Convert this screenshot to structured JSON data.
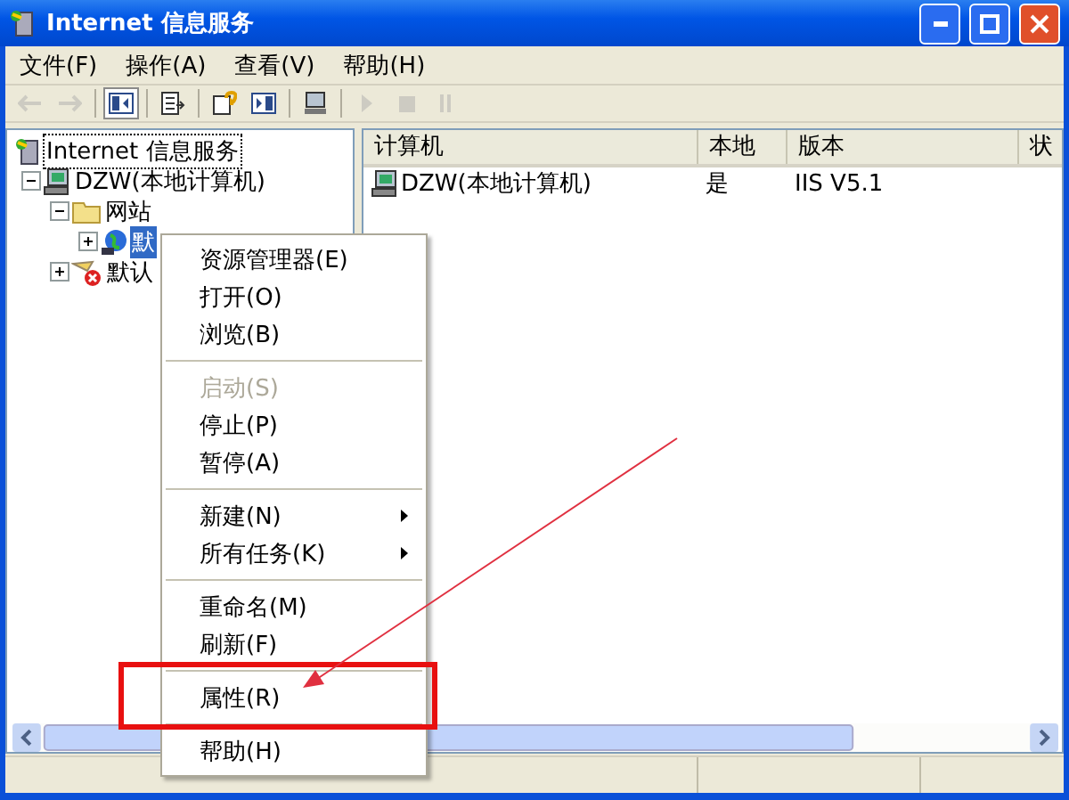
{
  "window": {
    "title": "Internet 信息服务"
  },
  "menu_bar": [
    {
      "label": "文件(F)"
    },
    {
      "label": "操作(A)"
    },
    {
      "label": "查看(V)"
    },
    {
      "label": "帮助(H)"
    }
  ],
  "toolbar": [
    {
      "kind": "back",
      "disabled": true,
      "pressed": false
    },
    {
      "kind": "forward",
      "disabled": true,
      "pressed": false
    },
    {
      "kind": "sep"
    },
    {
      "kind": "tree",
      "disabled": false,
      "pressed": true
    },
    {
      "kind": "sep"
    },
    {
      "kind": "export",
      "disabled": false,
      "pressed": false
    },
    {
      "kind": "sep"
    },
    {
      "kind": "help",
      "disabled": false,
      "pressed": false
    },
    {
      "kind": "pane",
      "disabled": false,
      "pressed": false
    },
    {
      "kind": "sep"
    },
    {
      "kind": "computer",
      "disabled": false,
      "pressed": false
    },
    {
      "kind": "sep"
    },
    {
      "kind": "play",
      "disabled": true,
      "pressed": false
    },
    {
      "kind": "stop",
      "disabled": true,
      "pressed": false
    },
    {
      "kind": "pause",
      "disabled": true,
      "pressed": false
    }
  ],
  "tree": [
    {
      "label": "Internet 信息服务",
      "kind": "iis",
      "focused": true,
      "selected": false,
      "children": [
        {
          "label": "DZW(本地计算机)",
          "kind": "computer",
          "expanded": true,
          "focused": false,
          "selected": false,
          "children": [
            {
              "label": "网站",
              "kind": "folder",
              "expanded": true,
              "focused": false,
              "selected": false,
              "children": [
                {
                  "label": "默",
                  "kind": "site",
                  "expanded": false,
                  "focused": false,
                  "selected": true
                }
              ]
            },
            {
              "label": "默认",
              "kind": "mail",
              "expanded": false,
              "focused": false,
              "selected": false
            }
          ]
        }
      ]
    }
  ],
  "table": {
    "columns": [
      "计算机",
      "本地",
      "版本",
      "状"
    ],
    "rows": [
      [
        "DZW(本地计算机)",
        "是",
        "IIS V5.1"
      ]
    ]
  },
  "context_menu": [
    {
      "kind": "item",
      "label": "资源管理器(E)",
      "disabled": false,
      "submenu": false
    },
    {
      "kind": "item",
      "label": "打开(O)",
      "disabled": false,
      "submenu": false
    },
    {
      "kind": "item",
      "label": "浏览(B)",
      "disabled": false,
      "submenu": false
    },
    {
      "kind": "separator"
    },
    {
      "kind": "item",
      "label": "启动(S)",
      "disabled": true,
      "submenu": false
    },
    {
      "kind": "item",
      "label": "停止(P)",
      "disabled": false,
      "submenu": false
    },
    {
      "kind": "item",
      "label": "暂停(A)",
      "disabled": false,
      "submenu": false
    },
    {
      "kind": "separator"
    },
    {
      "kind": "item",
      "label": "新建(N)",
      "disabled": false,
      "submenu": true
    },
    {
      "kind": "item",
      "label": "所有任务(K)",
      "disabled": false,
      "submenu": true
    },
    {
      "kind": "separator"
    },
    {
      "kind": "item",
      "label": "重命名(M)",
      "disabled": false,
      "submenu": false
    },
    {
      "kind": "item",
      "label": "刷新(F)",
      "disabled": false,
      "submenu": false
    },
    {
      "kind": "separator"
    },
    {
      "kind": "item",
      "label": "属性(R)",
      "disabled": false,
      "submenu": false
    },
    {
      "kind": "separator"
    },
    {
      "kind": "item",
      "label": "帮助(H)",
      "disabled": false,
      "submenu": false
    }
  ]
}
